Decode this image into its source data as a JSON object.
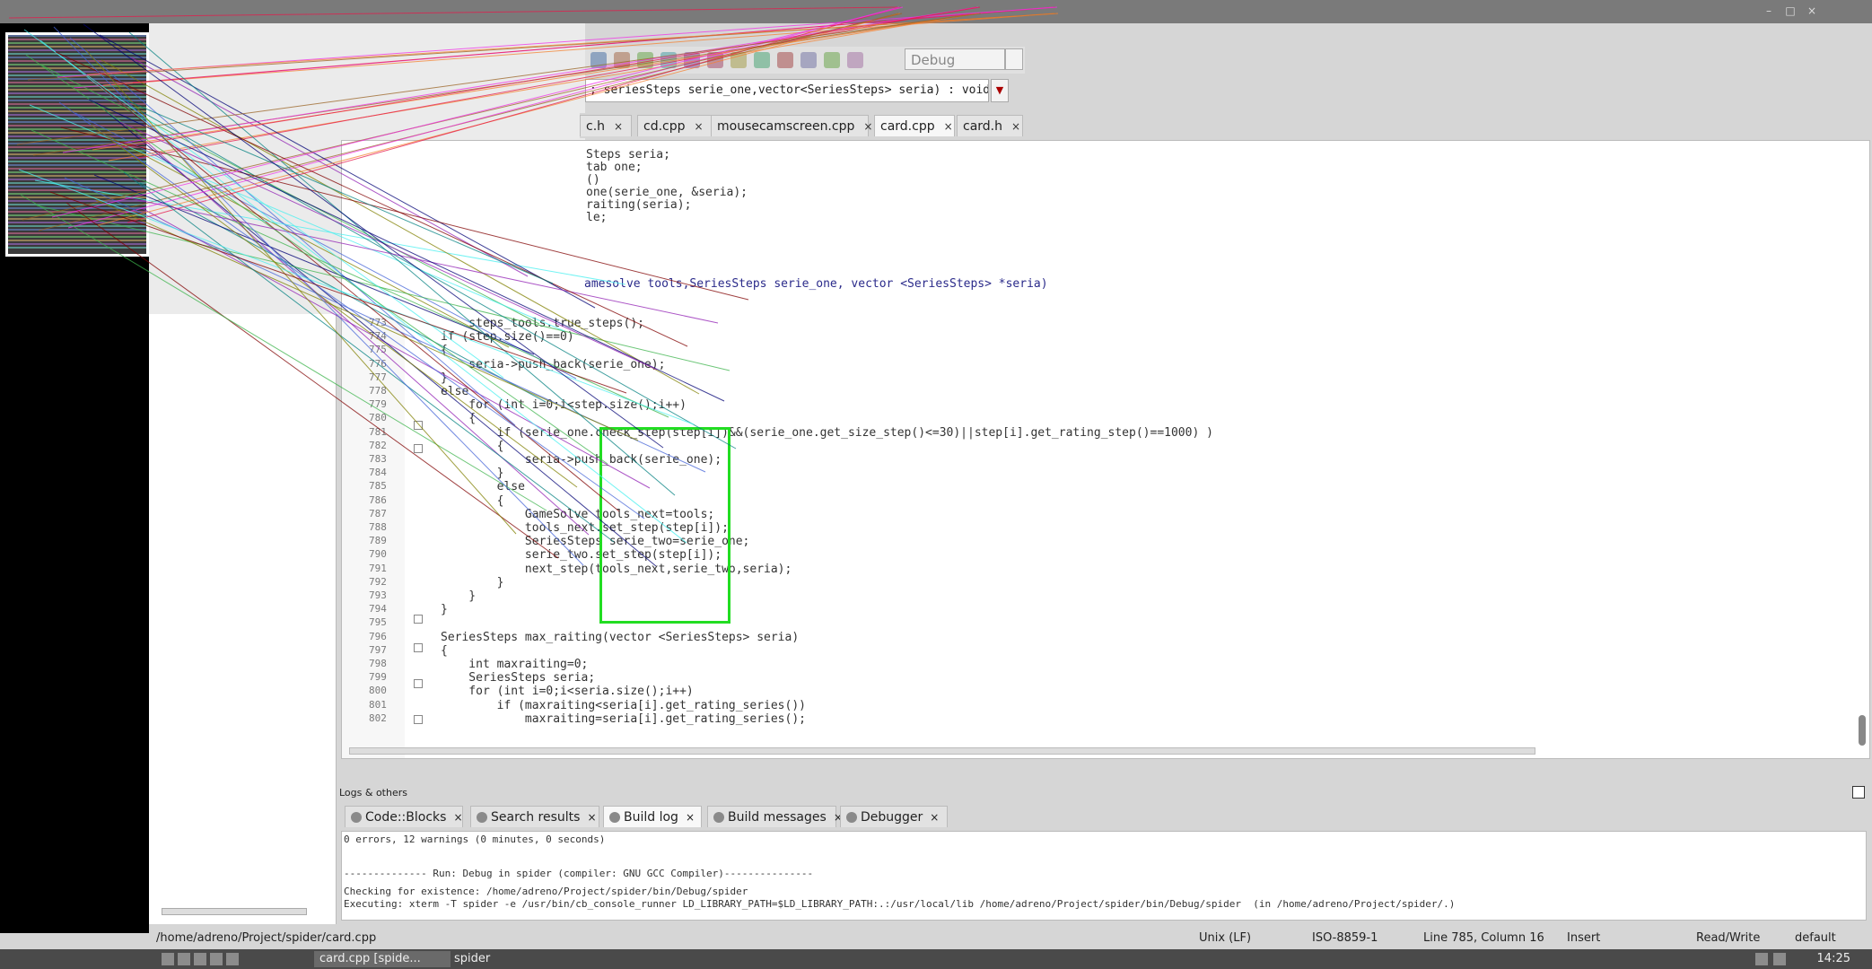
{
  "toolbar": {
    "build_target": "Debug",
    "symbol_text": "; seriesSteps serie_one,vector<SeriesSteps> seria) : void"
  },
  "editor_tabs": [
    {
      "label": "c.h"
    },
    {
      "label": "cd.cpp"
    },
    {
      "label": "mousecamscreen.cpp"
    },
    {
      "label": "card.cpp"
    },
    {
      "label": "card.h"
    }
  ],
  "code": {
    "top_lines": [
      "Steps seria;",
      "tab one;",
      "()",
      "one(serie_one, &seria);",
      "raiting(seria);",
      "le;"
    ],
    "func_sig": "amesolve tools,SeriesSteps serie_one, vector <SeriesSteps> *seria)",
    "lines": [
      {
        "ln": "773",
        "text": "    steps_tools.true_steps();"
      },
      {
        "ln": "774",
        "text": "if (step.size()==0)"
      },
      {
        "ln": "775",
        "text": "{"
      },
      {
        "ln": "776",
        "text": "    seria->push_back(serie_one);"
      },
      {
        "ln": "777",
        "text": "}"
      },
      {
        "ln": "778",
        "text": "else"
      },
      {
        "ln": "779",
        "text": "    for (int i=0;i<step.size();i++)"
      },
      {
        "ln": "780",
        "text": "    {"
      },
      {
        "ln": "781",
        "text": "        if (serie_one.check_step(step[i])&&(serie_one.get_size_step()<=30)||step[i].get_rating_step()==1000) )"
      },
      {
        "ln": "782",
        "text": "        {"
      },
      {
        "ln": "783",
        "text": "            seria->push_back(serie_one);"
      },
      {
        "ln": "784",
        "text": "        }"
      },
      {
        "ln": "785",
        "text": "        else"
      },
      {
        "ln": "786",
        "text": "        {"
      },
      {
        "ln": "787",
        "text": "            GameSolve tools_next=tools;"
      },
      {
        "ln": "788",
        "text": "            tools_next.set_step(step[i]);"
      },
      {
        "ln": "789",
        "text": "            SeriesSteps serie_two=serie_one;"
      },
      {
        "ln": "790",
        "text": "            serie_two.set_step(step[i]);"
      },
      {
        "ln": "791",
        "text": "            next_step(tools_next,serie_two,seria);"
      },
      {
        "ln": "792",
        "text": "        }"
      },
      {
        "ln": "793",
        "text": "    }"
      },
      {
        "ln": "794",
        "text": "}"
      },
      {
        "ln": "795",
        "text": ""
      },
      {
        "ln": "796",
        "text": "SeriesSteps max_raiting(vector <SeriesSteps> seria)"
      },
      {
        "ln": "797",
        "text": "{"
      },
      {
        "ln": "798",
        "text": "    int maxraiting=0;"
      },
      {
        "ln": "799",
        "text": "    SeriesSteps seria;"
      },
      {
        "ln": "800",
        "text": "    for (int i=0;i<seria.size();i++)"
      },
      {
        "ln": "801",
        "text": "        if (maxraiting<seria[i].get_rating_series())"
      },
      {
        "ln": "802",
        "text": "            maxraiting=seria[i].get_rating_series();"
      }
    ]
  },
  "logs": {
    "title": "Logs & others",
    "tabs": [
      {
        "label": "Code::Blocks"
      },
      {
        "label": "Search results"
      },
      {
        "label": "Build log"
      },
      {
        "label": "Build messages"
      },
      {
        "label": "Debugger"
      }
    ],
    "lines": [
      "0 errors, 12 warnings (0 minutes, 0 seconds)",
      "",
      "-------------- Run: Debug in spider (compiler: GNU GCC Compiler)---------------",
      "",
      "Checking for existence: /home/adreno/Project/spider/bin/Debug/spider",
      "Executing: xterm -T spider -e /usr/bin/cb_console_runner LD_LIBRARY_PATH=$LD_LIBRARY_PATH:.:/usr/local/lib /home/adreno/Project/spider/bin/Debug/spider  (in /home/adreno/Project/spider/.)"
    ]
  },
  "status": {
    "path": "/home/adreno/Project/spider/card.cpp",
    "eol": "Unix (LF)",
    "encoding": "ISO-8859-1",
    "position": "Line 785, Column 16",
    "mode": "Insert",
    "rw": "Read/Write",
    "lang": "default"
  },
  "taskbar": {
    "task1": "card.cpp [spide...",
    "task2": "spider",
    "clock": "14:25"
  }
}
